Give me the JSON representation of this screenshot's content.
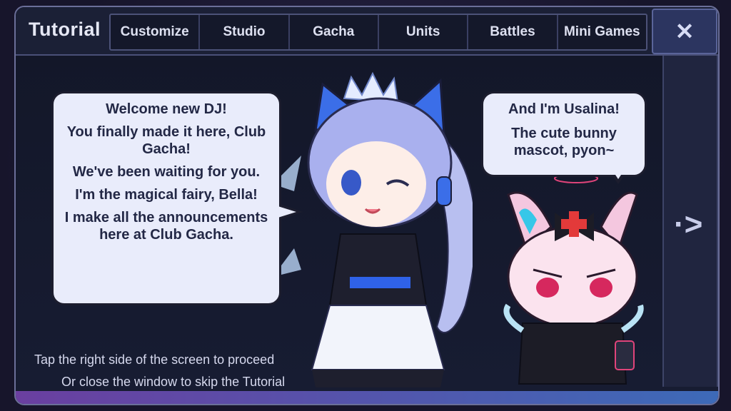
{
  "window": {
    "title": "Tutorial",
    "close_label": "✕"
  },
  "tabs": [
    {
      "label": "Customize"
    },
    {
      "label": "Studio"
    },
    {
      "label": "Gacha"
    },
    {
      "label": "Units"
    },
    {
      "label": "Battles"
    },
    {
      "label": "Mini Games"
    }
  ],
  "dialog_left": {
    "lines": [
      "Welcome new DJ!",
      "You finally made it here, Club Gacha!",
      "We've been waiting for you.",
      "I'm the magical fairy, Bella!",
      "I make all the announcements here at Club Gacha."
    ]
  },
  "dialog_right": {
    "lines": [
      "And I'm Usalina!",
      "The cute bunny mascot, pyon~"
    ]
  },
  "hints": {
    "proceed": "Tap the right side of the screen to proceed",
    "skip": "Or close the window to skip the Tutorial"
  },
  "next_arrow": "·>",
  "colors": {
    "panel": "#161a2e",
    "bubble": "#e9ecfb",
    "accent": "#2c3560"
  }
}
